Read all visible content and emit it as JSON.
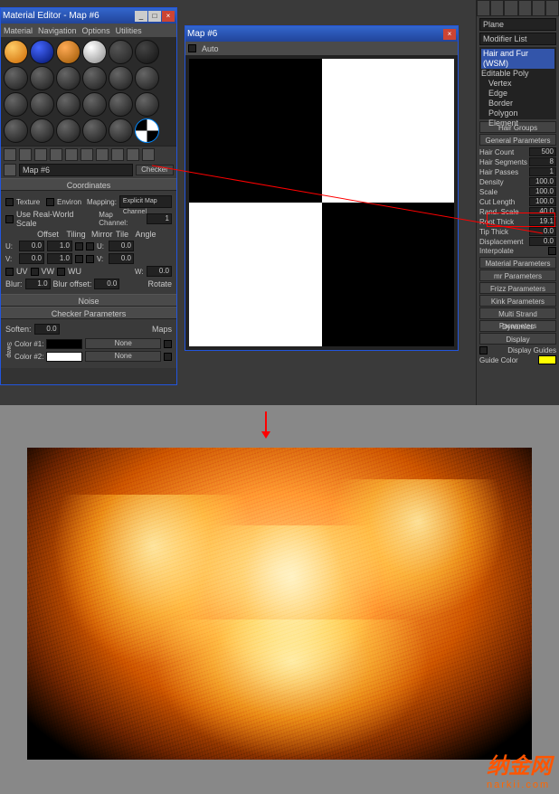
{
  "mat_editor": {
    "title": "Material Editor - Map #6",
    "menu": [
      "Material",
      "Navigation",
      "Options",
      "Utilities"
    ],
    "map_name": "Map #6",
    "map_type": "Checker",
    "rollouts": {
      "coordinates": {
        "title": "Coordinates",
        "texture": "Texture",
        "environ": "Environ",
        "mapping_label": "Mapping:",
        "mapping_value": "Explicit Map Channel",
        "real_world": "Use Real-World Scale",
        "map_channel_label": "Map Channel:",
        "map_channel": "1",
        "offset": "Offset",
        "tiling": "Tiling",
        "mirror": "Mirror",
        "tile": "Tile",
        "angle": "Angle",
        "u": "U:",
        "v": "V:",
        "w": "W:",
        "u_off": "0.0",
        "u_til": "1.0",
        "u_ang": "0.0",
        "v_off": "0.0",
        "v_til": "1.0",
        "v_ang": "0.0",
        "w_ang": "0.0",
        "uv": "UV",
        "vw": "VW",
        "wu": "WU",
        "blur_label": "Blur:",
        "blur": "1.0",
        "bluroff_label": "Blur offset:",
        "bluroff": "0.0",
        "rotate": "Rotate"
      },
      "noise": "Noise",
      "checker": {
        "title": "Checker Parameters",
        "soften_label": "Soften:",
        "soften": "0.0",
        "maps": "Maps",
        "swap": "Swap",
        "c1": "Color #1:",
        "c2": "Color #2:",
        "none": "None"
      }
    }
  },
  "map_preview": {
    "title": "Map #6",
    "auto": "Auto"
  },
  "command_panel": {
    "obj": "Plane",
    "modlist_label": "Modifier List",
    "mod_sel": "Hair and Fur (WSM)",
    "mod_base": "Editable Poly",
    "sub": [
      "Vertex",
      "Edge",
      "Border",
      "Polygon",
      "Element"
    ],
    "hair_groups": "Hair Groups",
    "general": {
      "title": "General Parameters",
      "hair_count_l": "Hair Count",
      "hair_count": "500",
      "hair_seg_l": "Hair Segments",
      "hair_seg": "8",
      "hair_pass_l": "Hair Passes",
      "hair_pass": "1",
      "density_l": "Density",
      "density": "100.0",
      "scale_l": "Scale",
      "scale": "100.0",
      "cut_l": "Cut Length",
      "cut": "100.0",
      "rand_l": "Rand. Scale",
      "rand": "40.0",
      "root_l": "Root Thick",
      "root": "19.1",
      "tip_l": "Tip Thick",
      "tip": "0.0",
      "disp_l": "Displacement",
      "disp": "0.0",
      "interp_l": "Interpolate"
    },
    "rollouts": [
      "Material Parameters",
      "mr Parameters",
      "Frizz Parameters",
      "Kink Parameters",
      "Multi Strand Parameters",
      "Dynamics",
      "Display"
    ],
    "display": {
      "guides": "Display Guides",
      "guide_color": "Guide Color"
    }
  },
  "watermark": {
    "cn": "纳金网",
    "en": "narkii.com"
  }
}
